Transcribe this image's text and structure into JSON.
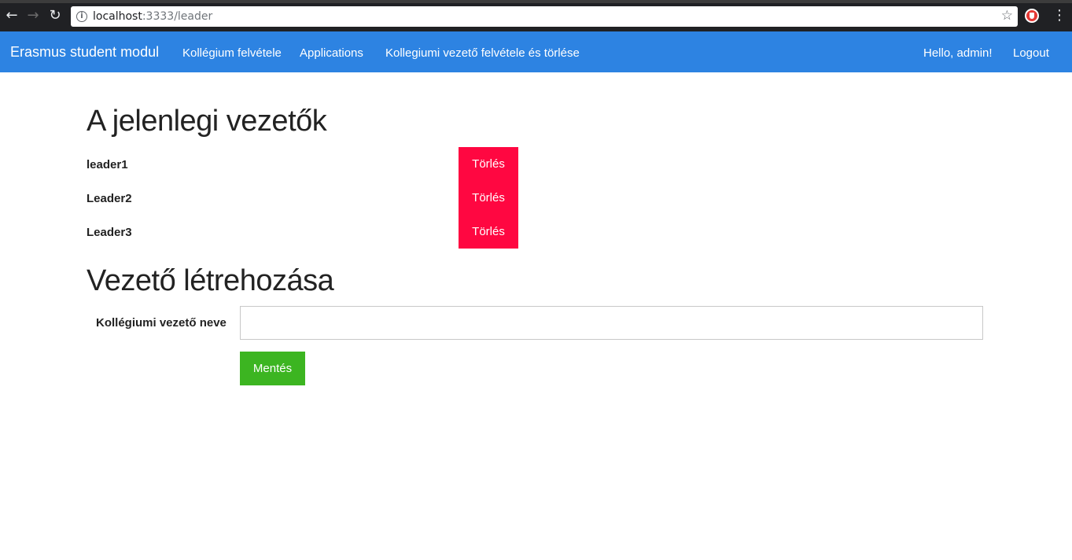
{
  "browser": {
    "url_host": "localhost",
    "url_path": ":3333/leader"
  },
  "navbar": {
    "brand": "Erasmus student modul",
    "links": [
      {
        "label": "Kollégium felvétele"
      },
      {
        "label": "Applications"
      },
      {
        "label": "Kollegiumi vezető felvétele és törlése"
      }
    ],
    "greeting": "Hello, admin!",
    "logout": "Logout"
  },
  "leaders_section": {
    "title": "A jelenlegi vezetők",
    "leaders": [
      {
        "name": "leader1",
        "delete_label": "Törlés"
      },
      {
        "name": "Leader2",
        "delete_label": "Törlés"
      },
      {
        "name": "Leader3",
        "delete_label": "Törlés"
      }
    ]
  },
  "create_section": {
    "title": "Vezető létrehozása",
    "field_label": "Kollégiumi vezető neve",
    "field_value": "",
    "field_placeholder": "",
    "save_label": "Mentés"
  },
  "colors": {
    "navbar": "#2d83e2",
    "delete_button": "#ff0741",
    "save_button": "#3cb521"
  }
}
